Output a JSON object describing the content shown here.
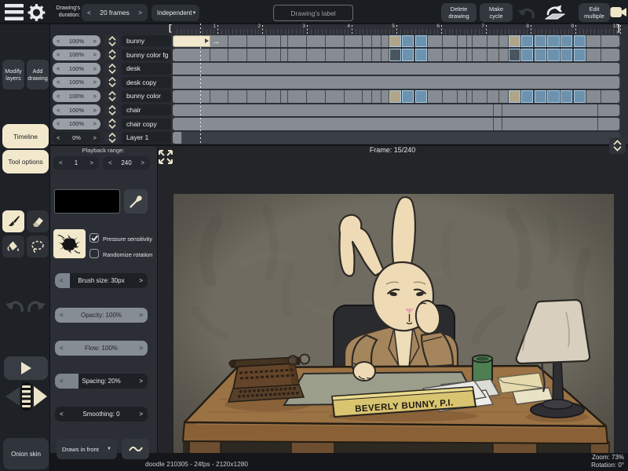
{
  "topbar": {
    "duration_label": "Drawing's duration:",
    "duration_value": "20 frames",
    "mode": "Independent",
    "label_placeholder": "Drawing's label",
    "delete": "Delete drawing",
    "make_cycle": "Make cycle",
    "edit_multiple": "Edit multiple"
  },
  "sidebar": {
    "modify_layers": "Modify layers",
    "add_drawing": "Add drawing",
    "timeline_tab": "Timeline",
    "tool_options_tab": "Tool options",
    "onion_skin": "Onion skin"
  },
  "playback": {
    "label": "Playback range:",
    "start": "1",
    "end": "240"
  },
  "timeline": {
    "frame_label": "Frame: 15/240",
    "playhead_frame": 15,
    "total_frames": 240,
    "seconds": [
      1,
      2,
      3,
      4,
      5,
      6,
      7,
      8,
      9,
      10
    ]
  },
  "layers": [
    {
      "opacity": "100%",
      "name": "bunny",
      "cells": [
        [
          20,
          "s"
        ],
        [
          10,
          "g"
        ],
        [
          10,
          "g"
        ],
        [
          10,
          "g"
        ],
        [
          8,
          "g"
        ],
        [
          4,
          "g"
        ],
        [
          10,
          "g"
        ],
        [
          10,
          "g"
        ],
        [
          10,
          "g"
        ],
        [
          10,
          "g"
        ],
        [
          5,
          "g"
        ],
        [
          5,
          "g"
        ],
        [
          4,
          "g"
        ],
        [
          7,
          "t"
        ],
        [
          7,
          "b"
        ],
        [
          7,
          "b"
        ],
        [
          8,
          "g"
        ],
        [
          8,
          "g"
        ],
        [
          5,
          "g"
        ],
        [
          3,
          "g"
        ],
        [
          8,
          "g"
        ],
        [
          6,
          "g"
        ],
        [
          5,
          "g"
        ],
        [
          7,
          "t"
        ],
        [
          7,
          "b"
        ],
        [
          7,
          "b"
        ],
        [
          7,
          "b"
        ],
        [
          7,
          "b"
        ],
        [
          7,
          "b"
        ],
        [
          8,
          "g"
        ],
        [
          10,
          "g"
        ]
      ]
    },
    {
      "opacity": "100%",
      "name": "bunny color fg",
      "cells": [
        [
          20,
          "g"
        ],
        [
          10,
          "g"
        ],
        [
          10,
          "g"
        ],
        [
          10,
          "g"
        ],
        [
          8,
          "g"
        ],
        [
          4,
          "g"
        ],
        [
          10,
          "g"
        ],
        [
          10,
          "g"
        ],
        [
          10,
          "g"
        ],
        [
          10,
          "g"
        ],
        [
          5,
          "g"
        ],
        [
          5,
          "g"
        ],
        [
          4,
          "g"
        ],
        [
          7,
          "d"
        ],
        [
          7,
          "b"
        ],
        [
          7,
          "b"
        ],
        [
          8,
          "g"
        ],
        [
          8,
          "g"
        ],
        [
          5,
          "g"
        ],
        [
          3,
          "g"
        ],
        [
          8,
          "g"
        ],
        [
          6,
          "g"
        ],
        [
          5,
          "g"
        ],
        [
          7,
          "d"
        ],
        [
          7,
          "b"
        ],
        [
          7,
          "b"
        ],
        [
          7,
          "b"
        ],
        [
          7,
          "b"
        ],
        [
          7,
          "b"
        ],
        [
          8,
          "g"
        ],
        [
          10,
          "g"
        ]
      ]
    },
    {
      "opacity": "100%",
      "name": "desk",
      "cells": [
        [
          240,
          "g"
        ]
      ]
    },
    {
      "opacity": "100%",
      "name": "desk copy",
      "cells": [
        [
          240,
          "g"
        ]
      ]
    },
    {
      "opacity": "100%",
      "name": "bunny color",
      "cells": [
        [
          20,
          "g"
        ],
        [
          10,
          "g"
        ],
        [
          10,
          "g"
        ],
        [
          10,
          "g"
        ],
        [
          8,
          "g"
        ],
        [
          4,
          "g"
        ],
        [
          10,
          "g"
        ],
        [
          10,
          "g"
        ],
        [
          10,
          "g"
        ],
        [
          10,
          "g"
        ],
        [
          5,
          "g"
        ],
        [
          5,
          "g"
        ],
        [
          4,
          "g"
        ],
        [
          7,
          "t"
        ],
        [
          7,
          "b"
        ],
        [
          7,
          "b"
        ],
        [
          8,
          "g"
        ],
        [
          8,
          "g"
        ],
        [
          5,
          "g"
        ],
        [
          3,
          "g"
        ],
        [
          8,
          "g"
        ],
        [
          6,
          "g"
        ],
        [
          5,
          "g"
        ],
        [
          7,
          "t"
        ],
        [
          7,
          "b"
        ],
        [
          7,
          "b"
        ],
        [
          7,
          "b"
        ],
        [
          7,
          "b"
        ],
        [
          7,
          "b"
        ],
        [
          8,
          "g"
        ],
        [
          10,
          "g"
        ]
      ]
    },
    {
      "opacity": "100%",
      "name": "chair",
      "cells": [
        [
          172,
          "g"
        ],
        [
          5,
          "g"
        ],
        [
          51,
          "g"
        ],
        [
          12,
          "g"
        ]
      ]
    },
    {
      "opacity": "100%",
      "name": "chair copy",
      "cells": [
        [
          172,
          "g"
        ],
        [
          5,
          "g"
        ],
        [
          51,
          "g"
        ],
        [
          12,
          "g"
        ]
      ]
    },
    {
      "opacity": "0%",
      "name": "Layer 1",
      "cells": [
        [
          5,
          "g"
        ],
        [
          235,
          "e"
        ]
      ]
    }
  ],
  "tools": {
    "pressure": "Pressure sensitivity",
    "randomize": "Randomize rotation",
    "sliders": [
      {
        "label": "Brush size: 30px",
        "fill": 0.16,
        "theme": "dark"
      },
      {
        "label": "Opacity: 100%",
        "fill": 1,
        "theme": "light"
      },
      {
        "label": "Flow: 100%",
        "fill": 1,
        "theme": "light"
      },
      {
        "label": "Spacing: 20%",
        "fill": 0.25,
        "theme": "dark"
      },
      {
        "label": "Smoothing: 0",
        "fill": 0,
        "theme": "dark"
      }
    ],
    "draws_in_front": "Draws in front"
  },
  "canvas": {
    "nameplate": "BEVERLY BUNNY, P.I."
  },
  "statusbar": {
    "info": "doodle 210305 - 24fps - 2120x1280",
    "zoom": "Zoom: 73%",
    "rotation": "Rotation: 0°"
  }
}
